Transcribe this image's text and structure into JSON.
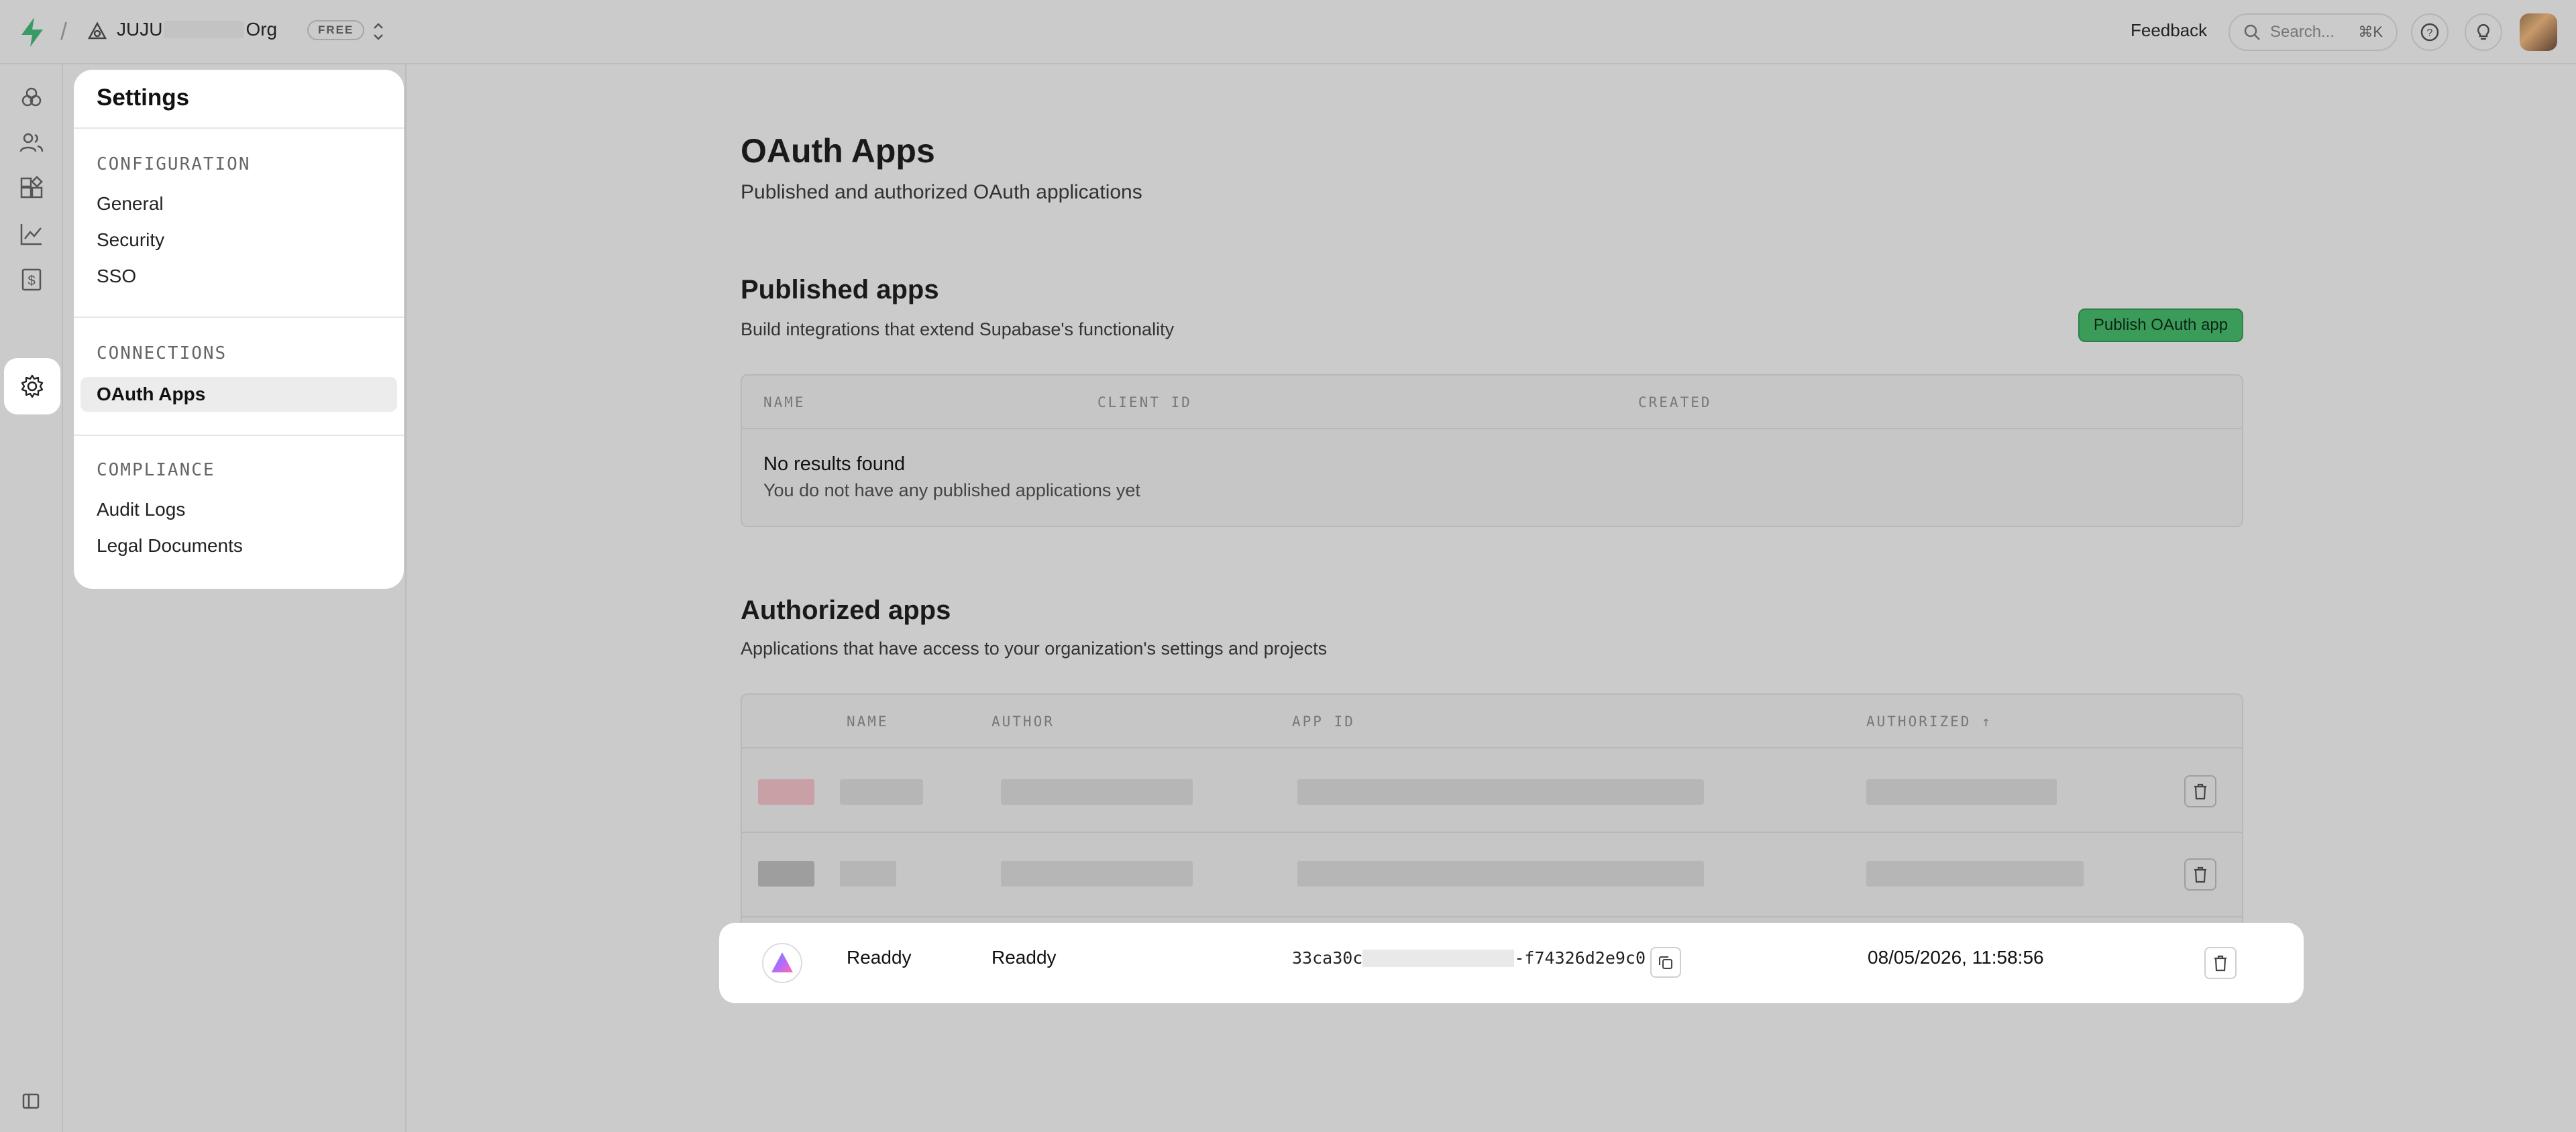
{
  "topbar": {
    "org_name_start": "JUJU",
    "org_name_end": "Org",
    "plan_badge": "FREE",
    "feedback_label": "Feedback",
    "search_placeholder": "Search...",
    "search_shortcut": "⌘K"
  },
  "settings_menu": {
    "title": "Settings",
    "sections": [
      {
        "heading": "CONFIGURATION",
        "items": [
          "General",
          "Security",
          "SSO"
        ]
      },
      {
        "heading": "CONNECTIONS",
        "items": [
          "OAuth Apps"
        ]
      },
      {
        "heading": "COMPLIANCE",
        "items": [
          "Audit Logs",
          "Legal Documents"
        ]
      }
    ],
    "active_item": "OAuth Apps"
  },
  "page": {
    "title": "OAuth Apps",
    "subtitle": "Published and authorized OAuth applications"
  },
  "published": {
    "title": "Published apps",
    "description": "Build integrations that extend Supabase's functionality",
    "publish_button": "Publish OAuth app",
    "columns": [
      "NAME",
      "CLIENT ID",
      "CREATED"
    ],
    "empty_title": "No results found",
    "empty_description": "You do not have any published applications yet"
  },
  "authorized": {
    "title": "Authorized apps",
    "description": "Applications that have access to your organization's settings and projects",
    "columns": [
      "NAME",
      "AUTHOR",
      "APP ID",
      "AUTHORIZED ↑"
    ],
    "rows": [
      {
        "name": "Readdy",
        "author": "Readdy",
        "app_id_start": "33ca30c",
        "app_id_end": "-f74326d2e9c0",
        "authorized": "08/05/2026, 11:58:56"
      }
    ]
  },
  "colors": {
    "brand_green": "#3ECF8E",
    "publish_button": "#3b9c5a"
  }
}
